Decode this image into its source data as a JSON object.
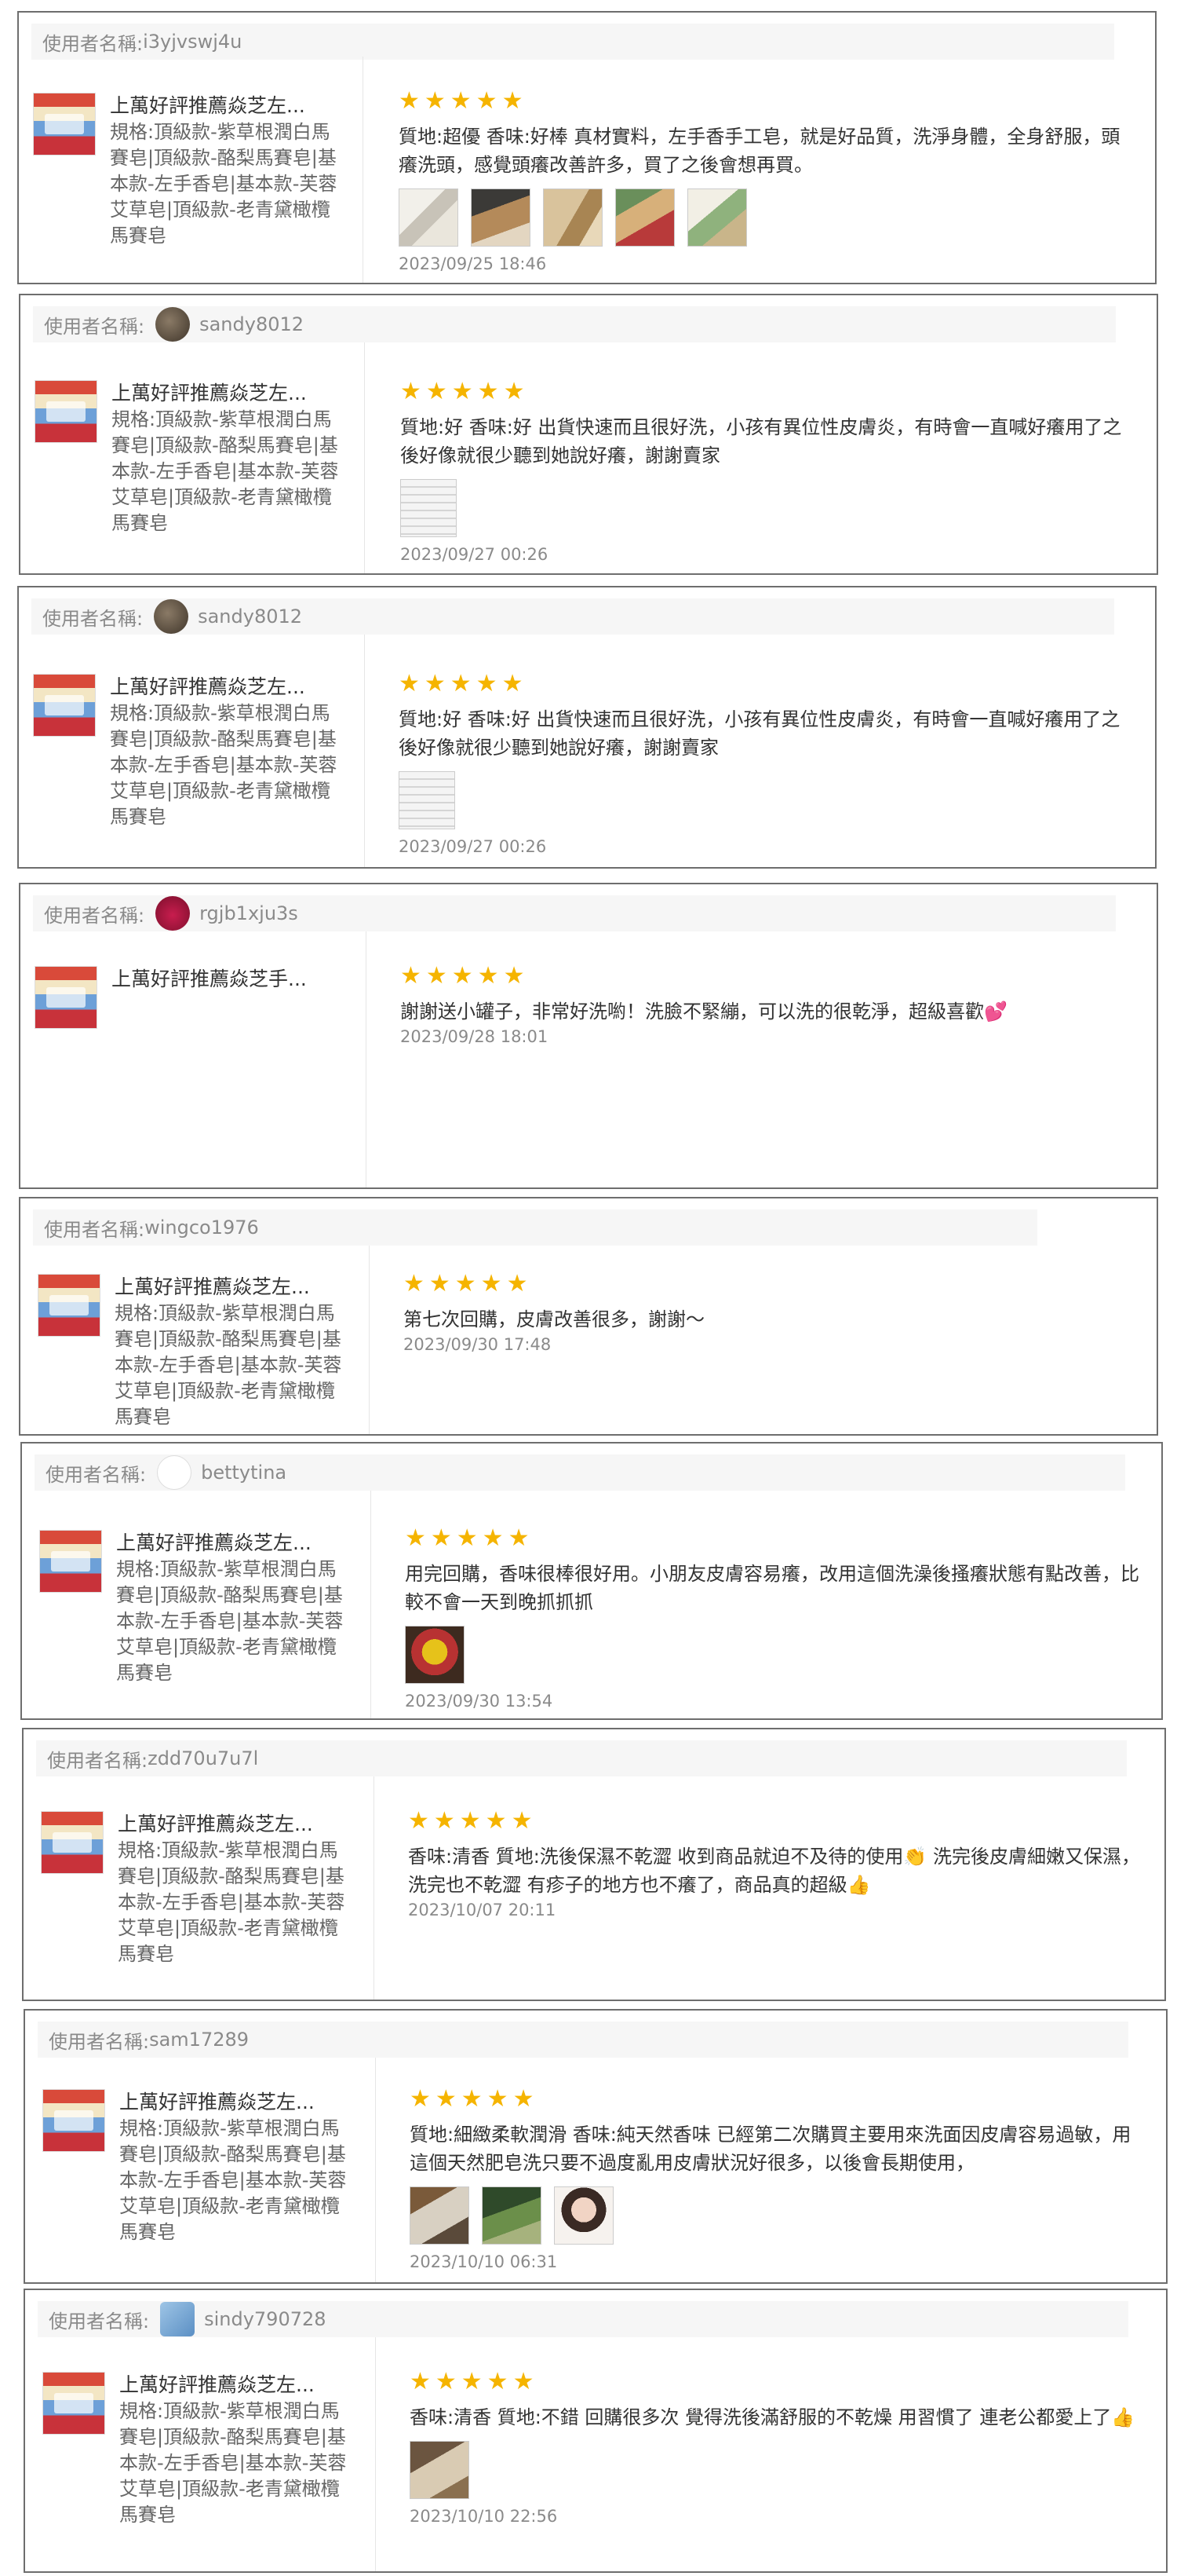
{
  "labels": {
    "username_prefix": "使用者名稱:",
    "username_prefix_space": "使用者名稱: ",
    "product_name": "上萬好評推薦焱芝左...",
    "product_name_alt": "上萬好評推薦焱芝手...",
    "spec": "規格:頂級款-紫草根潤白馬賽皂|頂級款-酪梨馬賽皂|基本款-左手香皂|基本款-芙蓉艾草皂|頂級款-老青黛橄欖馬賽皂",
    "stars": "★★★★★"
  },
  "colors": {
    "star": "#f5b400",
    "border": "#6e6e6e",
    "header_bg": "#f6f6f6"
  },
  "reviews": [
    {
      "username": "i3yjvswj4u",
      "avatar": "none",
      "text": "質地:超優 香味:好棒 真材實料，左手香手工皂，就是好品質，洗淨身體，全身舒服，頭癢洗頭，感覺頭癢改善許多，買了之後會想再買。",
      "photos": [
        "package-photo",
        "box-photo",
        "parcel-photo",
        "soap-photo",
        "card-photo"
      ],
      "date": "2023/09/25 18:46"
    },
    {
      "username": "sandy8012",
      "avatar": "photo-avatar",
      "text": "質地:好 香味:好 出貨快速而且很好洗，小孩有異位性皮膚炎，有時會一直喊好癢用了之後好像就很少聽到她說好癢，謝謝賣家",
      "photos": [
        "screenshot-photo"
      ],
      "date": "2023/09/27 00:26"
    },
    {
      "username": "sandy8012",
      "avatar": "photo-avatar",
      "text": "質地:好 香味:好 出貨快速而且很好洗，小孩有異位性皮膚炎，有時會一直喊好癢用了之後好像就很少聽到她說好癢，謝謝賣家",
      "photos": [
        "screenshot-photo"
      ],
      "date": "2023/09/27 00:26"
    },
    {
      "username": "rgjb1xju3s",
      "avatar": "apple-avatar",
      "text": "謝謝送小罐子，非常好洗喲！洗臉不緊繃，可以洗的很乾淨，超級喜歡💕",
      "photos": [],
      "date": "2023/09/28 18:01"
    },
    {
      "username": "wingco1976",
      "avatar": "none",
      "text": "第七次回購，皮膚改善很多，謝謝～",
      "photos": [],
      "date": "2023/09/30 17:48"
    },
    {
      "username": "bettytina",
      "avatar": "logo-avatar",
      "text": "用完回購，香味很棒很好用。小朋友皮膚容易癢，改用這個洗澡後搔癢狀態有點改善，比較不會一天到晚抓抓抓",
      "photos": [
        "toy-photo"
      ],
      "date": "2023/09/30 13:54"
    },
    {
      "username": "zdd70u7u7l",
      "avatar": "none",
      "text": "香味:清香 質地:洗後保濕不乾澀 收到商品就迫不及待的使用👏 洗完後皮膚細嫩又保濕， 洗完也不乾澀 有疹子的地方也不癢了，商品真的超級👍",
      "photos": [],
      "date": "2023/10/07 20:11"
    },
    {
      "username": "sam17289",
      "avatar": "none",
      "text": "質地:細緻柔軟潤滑 香味:純天然香味 已經第二次購買主要用來洗面因皮膚容易過敏，用這個天然肥皂洗只要不過度亂用皮膚狀況好很多，以後會長期使用，",
      "photos": [
        "box-photo",
        "plant-photo",
        "portrait-photo"
      ],
      "date": "2023/10/10 06:31"
    },
    {
      "username": "sindy790728",
      "avatar": "cartoon-avatar",
      "text": "香味:清香 質地:不錯 回購很多次 覺得洗後滿舒服的不乾燥 用習慣了 連老公都愛上了👍",
      "photos": [
        "box-photo"
      ],
      "date": "2023/10/10 22:56"
    }
  ]
}
